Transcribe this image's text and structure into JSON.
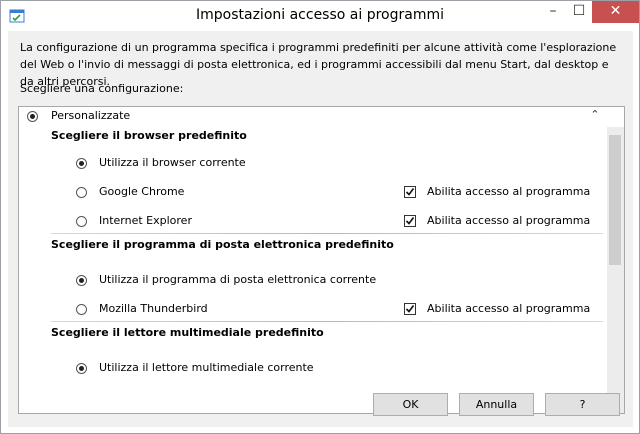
{
  "window": {
    "title": "Impostazioni accesso ai programmi",
    "min_glyph": "–",
    "max_glyph": "☐",
    "close_glyph": "✕"
  },
  "description": "La configurazione di un programma specifica i programmi predefiniti per alcune attività come l'esplorazione del Web o l'invio di messaggi di posta elettronica, ed i programmi accessibili dal menu Start, dal desktop e da altri percorsi.",
  "choose_label": "Scegliere una configurazione:",
  "config": {
    "label": "Personalizzate",
    "collapse_glyph": "⌃",
    "sections": [
      {
        "title": "Scegliere il browser predefinito",
        "options": [
          {
            "label": "Utilizza il browser corrente",
            "checked": true
          },
          {
            "label": "Google Chrome",
            "checked": false,
            "access_label": "Abilita accesso al programma"
          },
          {
            "label": "Internet Explorer",
            "checked": false,
            "access_label": "Abilita accesso al programma"
          }
        ]
      },
      {
        "title": "Scegliere il programma di posta elettronica predefinito",
        "options": [
          {
            "label": "Utilizza il programma di posta elettronica corrente",
            "checked": true
          },
          {
            "label": "Mozilla Thunderbird",
            "checked": false,
            "access_label": "Abilita accesso al programma"
          }
        ]
      },
      {
        "title": "Scegliere il lettore multimediale predefinito",
        "options": [
          {
            "label": "Utilizza il lettore multimediale corrente",
            "checked": true
          }
        ]
      }
    ]
  },
  "buttons": {
    "ok": "OK",
    "cancel": "Annulla",
    "help": "?"
  },
  "scroll_down_glyph": "⌄",
  "colors": {
    "close_button": "#c75050",
    "window_bg": "#f0f0f0",
    "separator_accent": "#9bbfe8"
  }
}
